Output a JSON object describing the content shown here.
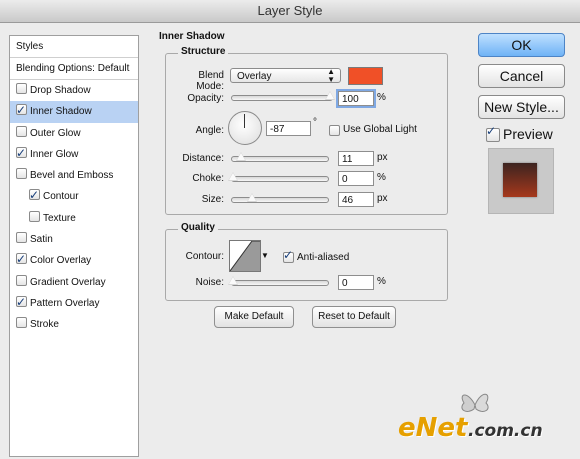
{
  "window": {
    "title": "Layer Style"
  },
  "styles_list": {
    "header": "Styles",
    "blending_options": "Blending Options: Default",
    "items": [
      {
        "label": "Drop Shadow",
        "checked": false,
        "sub": false,
        "selected": false
      },
      {
        "label": "Inner Shadow",
        "checked": true,
        "sub": false,
        "selected": true
      },
      {
        "label": "Outer Glow",
        "checked": false,
        "sub": false,
        "selected": false
      },
      {
        "label": "Inner Glow",
        "checked": true,
        "sub": false,
        "selected": false
      },
      {
        "label": "Bevel and Emboss",
        "checked": false,
        "sub": false,
        "selected": false
      },
      {
        "label": "Contour",
        "checked": true,
        "sub": true,
        "selected": false
      },
      {
        "label": "Texture",
        "checked": false,
        "sub": true,
        "selected": false
      },
      {
        "label": "Satin",
        "checked": false,
        "sub": false,
        "selected": false
      },
      {
        "label": "Color Overlay",
        "checked": true,
        "sub": false,
        "selected": false
      },
      {
        "label": "Gradient Overlay",
        "checked": false,
        "sub": false,
        "selected": false
      },
      {
        "label": "Pattern Overlay",
        "checked": true,
        "sub": false,
        "selected": false
      },
      {
        "label": "Stroke",
        "checked": false,
        "sub": false,
        "selected": false
      }
    ]
  },
  "inner_shadow": {
    "section_title": "Inner Shadow",
    "structure": {
      "title": "Structure",
      "blend_mode_label": "Blend Mode:",
      "blend_mode_value": "Overlay",
      "shadow_color": "#f05027",
      "opacity_label": "Opacity:",
      "opacity_value": "100",
      "opacity_unit": "%",
      "angle_label": "Angle:",
      "angle_value": "-87",
      "angle_unit": "°",
      "use_global_light_label": "Use Global Light",
      "use_global_light": false,
      "distance_label": "Distance:",
      "distance_value": "11",
      "distance_unit": "px",
      "choke_label": "Choke:",
      "choke_value": "0",
      "choke_unit": "%",
      "size_label": "Size:",
      "size_value": "46",
      "size_unit": "px"
    },
    "quality": {
      "title": "Quality",
      "contour_label": "Contour:",
      "anti_aliased_label": "Anti-aliased",
      "anti_aliased": true,
      "noise_label": "Noise:",
      "noise_value": "0",
      "noise_unit": "%"
    },
    "make_default_label": "Make Default",
    "reset_default_label": "Reset to Default"
  },
  "buttons": {
    "ok": "OK",
    "cancel": "Cancel",
    "new_style": "New Style..."
  },
  "preview": {
    "label": "Preview",
    "checked": true
  },
  "watermark": {
    "part1": "eNet",
    "part2": ".com.cn"
  }
}
